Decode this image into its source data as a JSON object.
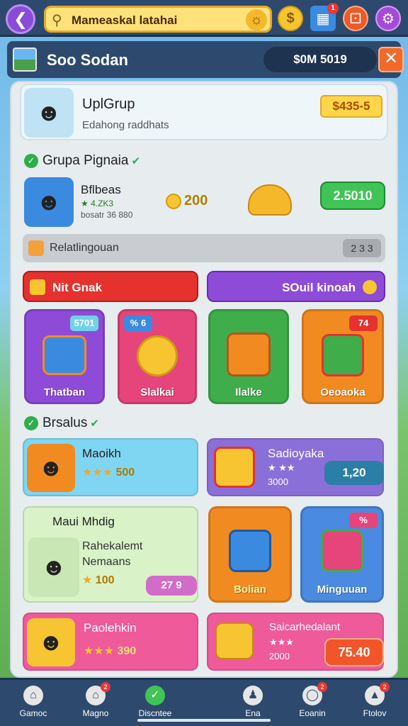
{
  "header": {
    "search_text": "Mameaskal latahai",
    "icons": [
      "back-icon",
      "search-icon",
      "sun-icon",
      "coin-icon",
      "cube-icon",
      "dice-icon",
      "gear-icon"
    ],
    "cube_badge": "1"
  },
  "title_bar": {
    "title": "Soo Sodan",
    "balance": "$0M 5019",
    "close": "✕"
  },
  "upgroup": {
    "title": "UplGrup",
    "subtitle": "Edahong raddhats",
    "price": "$435-5"
  },
  "grupa": {
    "heading": "Grupa Pignaia",
    "name": "Bflbeas",
    "stars": "★ 4.ZK3",
    "sub": "bosatr 36 880",
    "coins": "200",
    "button": "2.5010"
  },
  "info_bar": {
    "text": "Relatlingouan",
    "count": "2 3 3"
  },
  "tabs": {
    "left": "Nit Gnak",
    "right": "SOuil kinoah"
  },
  "categories": [
    {
      "name": "Thatban",
      "tag": "5701",
      "color": "#8e4bd8"
    },
    {
      "name": "Slalkai",
      "tag": "% 6",
      "color": "#e5457a"
    },
    {
      "name": "Ilalke",
      "tag": "",
      "color": "#3fae4a"
    },
    {
      "name": "Oeoaoka",
      "tag": "74",
      "color": "#f28a22"
    }
  ],
  "specials": {
    "heading": "Brsalus",
    "card1": {
      "name": "Maoikh",
      "stars": "★★★",
      "value": "500"
    },
    "card2": {
      "name": "Sadioyaka",
      "sub": "3000",
      "stars": "★ ★★",
      "price": "1,20"
    },
    "card3": {
      "name": "Maui Mhdig",
      "line1": "Rahekalemt",
      "line2": "Nemaans",
      "value": "100",
      "price": "27 9"
    },
    "card4": {
      "name": "Bolian"
    },
    "card5": {
      "name": "Minguuan",
      "tag": "%"
    },
    "card6": {
      "name": "Paolehkin",
      "stars": "★★★",
      "value": "390"
    },
    "card7": {
      "name": "Saicarhedalant",
      "stars": "★★★",
      "sub": "2000",
      "price": "75.40"
    }
  },
  "nav": {
    "items": [
      {
        "label": "Gamoc",
        "icon": "home-icon"
      },
      {
        "label": "Magno",
        "icon": "house-icon",
        "badge": "2"
      },
      {
        "label": "Discntee",
        "icon": "check-icon"
      },
      {
        "label": "Ena",
        "icon": "person-icon"
      },
      {
        "label": "Eoanin",
        "icon": "globe-icon",
        "badge": "2"
      },
      {
        "label": "Ftolov",
        "icon": "chart-icon",
        "badge": "2"
      }
    ]
  },
  "colors": {
    "nav_bg": "#2d4a6e",
    "accent_green": "#3fc455",
    "accent_red": "#e5322e",
    "accent_purple": "#8e4bd8",
    "accent_orange": "#f28a22",
    "coin_gold": "#f6c531"
  }
}
